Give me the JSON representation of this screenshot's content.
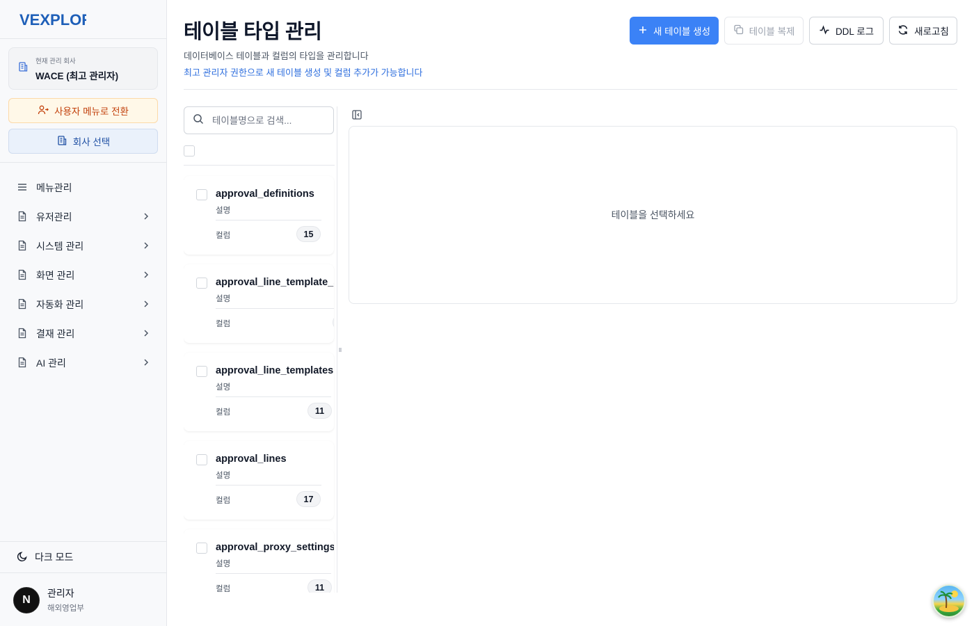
{
  "brand": {
    "logo_text": "VEXPLOR"
  },
  "sidebar": {
    "company": {
      "label": "현재 관리 회사",
      "value": "WACE (최고 관리자)"
    },
    "switch_to_user_menu": "사용자 메뉴로 전환",
    "select_company": "회사 선택",
    "nav": [
      {
        "label": "메뉴관리",
        "icon": "menu-icon",
        "expandable": false
      },
      {
        "label": "유저관리",
        "icon": "document-icon",
        "expandable": true
      },
      {
        "label": "시스템 관리",
        "icon": "document-icon",
        "expandable": true
      },
      {
        "label": "화면 관리",
        "icon": "document-icon",
        "expandable": true
      },
      {
        "label": "자동화 관리",
        "icon": "document-icon",
        "expandable": true
      },
      {
        "label": "결재 관리",
        "icon": "document-icon",
        "expandable": true
      },
      {
        "label": "AI 관리",
        "icon": "document-icon",
        "expandable": true
      }
    ],
    "dark_mode": "다크 모드",
    "user": {
      "initial": "N",
      "name": "관리자",
      "department": "해외영업부"
    }
  },
  "header": {
    "title": "테이블 타입 관리",
    "description": "데이터베이스 테이블과 컬럼의 타입을 관리합니다",
    "note": "최고 관리자 권한으로 새 테이블 생성 및 컬럼 추가가 가능합니다",
    "buttons": {
      "create": "새 테이블 생성",
      "duplicate": "테이블 복제",
      "ddl_log": "DDL 로그",
      "refresh": "새로고침"
    }
  },
  "search": {
    "placeholder": "테이블명으로 검색..."
  },
  "tables": [
    {
      "name": "approval_definitions",
      "description": "설명",
      "column_label": "컬럼",
      "column_count": "15"
    },
    {
      "name": "approval_line_template_steps",
      "description": "설명",
      "column_label": "컬럼",
      "column_count": ""
    },
    {
      "name": "approval_line_templates",
      "description": "설명",
      "column_label": "컬럼",
      "column_count": "11"
    },
    {
      "name": "approval_lines",
      "description": "설명",
      "column_label": "컬럼",
      "column_count": "17"
    },
    {
      "name": "approval_proxy_settings",
      "description": "설명",
      "column_label": "컬럼",
      "column_count": "11"
    }
  ],
  "detail": {
    "empty_message": "테이블을 선택하세요"
  },
  "colors": {
    "primary": "#3b82f6",
    "accent_link": "#2f6fde",
    "warning_bg": "#fff8e8",
    "warning_text": "#c2410c"
  }
}
